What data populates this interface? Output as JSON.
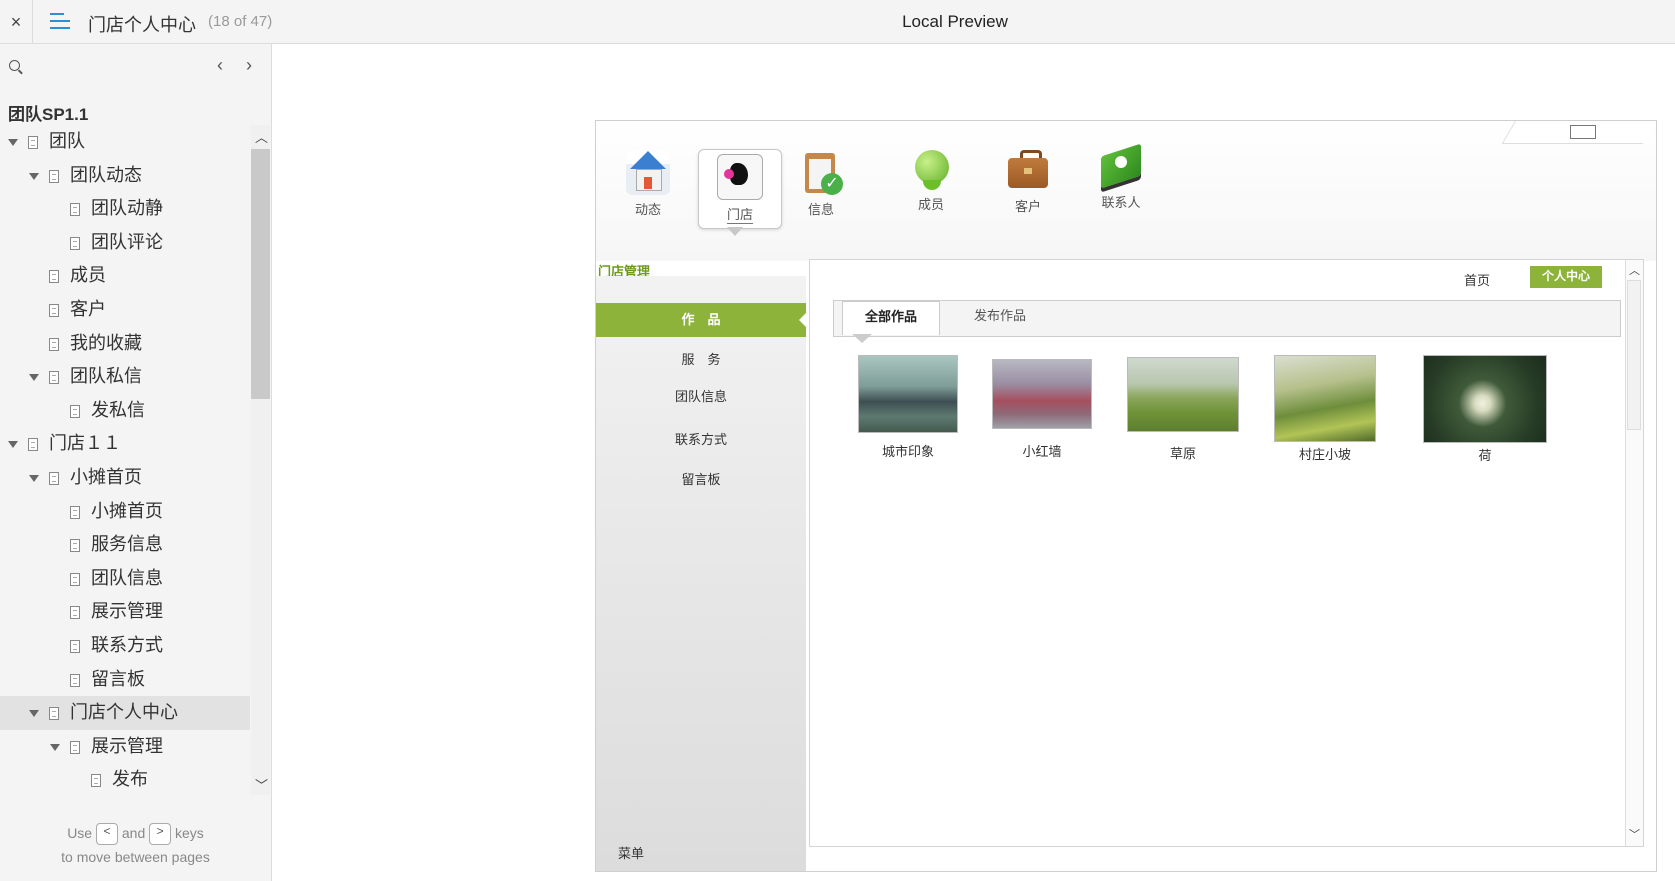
{
  "topbar": {
    "close": "×",
    "page_title": "门店个人中心",
    "page_count": "(18 of 47)",
    "preview_title": "Local Preview"
  },
  "sidebar": {
    "project_title": "团队SP1.1",
    "items": [
      {
        "label": "团队",
        "level": 0,
        "caret": true,
        "selected": false
      },
      {
        "label": "团队动态",
        "level": 1,
        "caret": true,
        "selected": false
      },
      {
        "label": "团队动静",
        "level": 2,
        "caret": false,
        "selected": false
      },
      {
        "label": "团队评论",
        "level": 2,
        "caret": false,
        "selected": false
      },
      {
        "label": "成员",
        "level": 1,
        "caret": false,
        "selected": false
      },
      {
        "label": "客户",
        "level": 1,
        "caret": false,
        "selected": false
      },
      {
        "label": "我的收藏",
        "level": 1,
        "caret": false,
        "selected": false
      },
      {
        "label": "团队私信",
        "level": 1,
        "caret": true,
        "selected": false
      },
      {
        "label": "发私信",
        "level": 2,
        "caret": false,
        "selected": false
      },
      {
        "label": "门店１１",
        "level": 0,
        "caret": true,
        "selected": false
      },
      {
        "label": "小摊首页",
        "level": 1,
        "caret": true,
        "selected": false
      },
      {
        "label": "小摊首页",
        "level": 2,
        "caret": false,
        "selected": false
      },
      {
        "label": "服务信息",
        "level": 2,
        "caret": false,
        "selected": false
      },
      {
        "label": "团队信息",
        "level": 2,
        "caret": false,
        "selected": false
      },
      {
        "label": "展示管理",
        "level": 2,
        "caret": false,
        "selected": false
      },
      {
        "label": "联系方式",
        "level": 2,
        "caret": false,
        "selected": false
      },
      {
        "label": "留言板",
        "level": 2,
        "caret": false,
        "selected": false
      },
      {
        "label": "门店个人中心",
        "level": 1,
        "caret": true,
        "selected": true
      },
      {
        "label": "展示管理",
        "level": 2,
        "caret": true,
        "selected": false
      },
      {
        "label": "发布",
        "level": 3,
        "caret": false,
        "selected": false
      }
    ],
    "hint_use": "Use",
    "hint_prev_key": "<",
    "hint_and": "and",
    "hint_next_key": ">",
    "hint_keys": "keys",
    "hint_line2": "to move between pages"
  },
  "prototype": {
    "apps": [
      {
        "label": "动态",
        "icon": "house-icon"
      },
      {
        "label": "门店",
        "icon": "shop-icon"
      },
      {
        "label": "信息",
        "icon": "clipboard-check-icon"
      },
      {
        "label": "成员",
        "icon": "member-icon"
      },
      {
        "label": "客户",
        "icon": "briefcase-icon"
      },
      {
        "label": "联系人",
        "icon": "contact-book-icon"
      }
    ],
    "section_label": "门店管理",
    "left_nav": [
      "作　品",
      "服　务",
      "团队信息",
      "联系方式",
      "留言板"
    ],
    "menu_label": "菜单",
    "home_link": "首页",
    "center_badge": "个人中心",
    "tabs": [
      "全部作品",
      "发布作品"
    ],
    "works": [
      {
        "caption": "城市印象"
      },
      {
        "caption": "小红墙"
      },
      {
        "caption": "草原"
      },
      {
        "caption": "村庄小坡"
      },
      {
        "caption": "荷"
      }
    ],
    "colors": {
      "accent": "#8db33a",
      "label_green": "#6d9a1d",
      "link_blue": "#2b8fd6"
    }
  }
}
